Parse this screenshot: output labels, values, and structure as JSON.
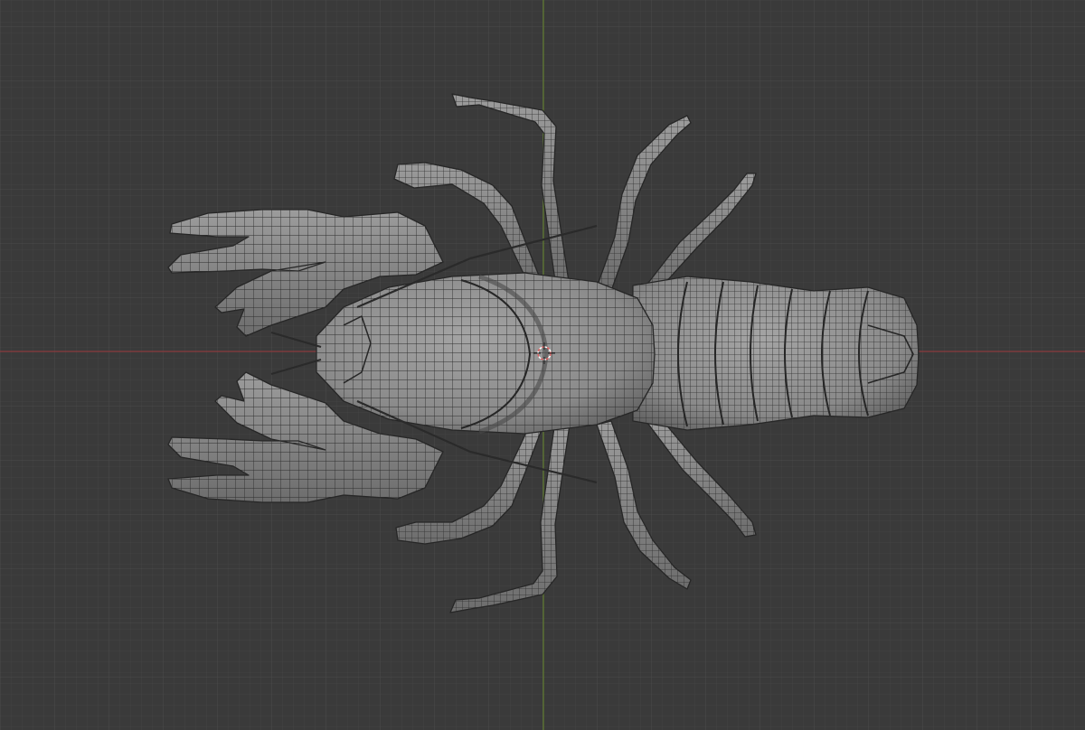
{
  "viewport": {
    "view": "top-orthographic",
    "model": "crayfish",
    "display": "wireframe-overlay"
  },
  "colors": {
    "background": "#3a3a3a",
    "grid_minor": "#434343",
    "grid_major": "#4a4a4a",
    "axis_x": "#8a3b3e",
    "axis_y": "#5f7a2e",
    "mesh_fill": "#8f8f8f",
    "mesh_fill_dark": "#6e6e6e",
    "mesh_wire": "#2b2b2b",
    "cursor": "#e06060"
  },
  "icons": {
    "cursor": "3d-cursor-icon"
  }
}
